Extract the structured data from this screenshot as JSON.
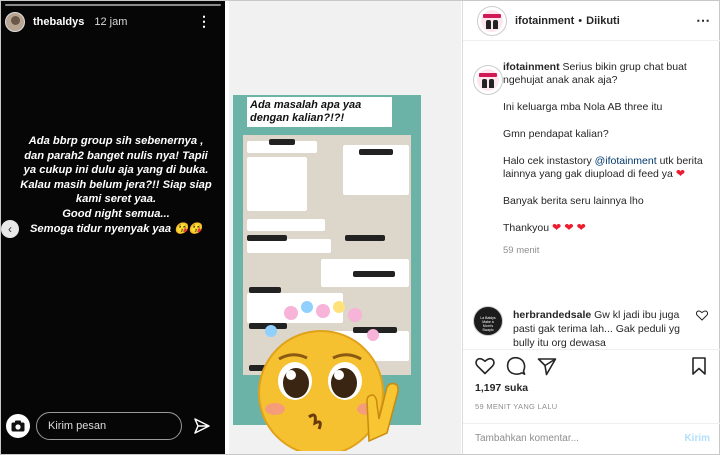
{
  "story": {
    "username": "thebaldys",
    "time": "12 jam",
    "lines": [
      "Ada bbrp group sih sebenernya ,",
      "dan parah2 banget nulis nya! Tapii",
      "ya cukup ini dulu aja yang di buka.",
      "Kalau masih belum jera?!! Siap siap",
      "kami seret yaa.",
      "Good night semua...",
      "Semoga tidur nyenyak yaa 😘😘"
    ],
    "message_placeholder": "Kirim pesan"
  },
  "post_media": {
    "caption_line1": "Ada masalah apa yaa",
    "caption_line2": "dengan kalian?!?!"
  },
  "post": {
    "header": {
      "username": "ifotainment",
      "separator": "•",
      "follow_status": "Diikuti"
    },
    "caption": {
      "username": "ifotainment",
      "line1": "Serius bikin grup chat buat ngehujat anak anak aja?",
      "line2": "Ini keluarga mba Nola AB three itu",
      "line3": "Gmn pendapat kalian?",
      "line4_before": "Halo cek instastory ",
      "line4_mention": "@ifotainment",
      "line4_after": " utk berita lainnya yang gak diupload di feed ya",
      "line5": "Banyak berita seru lainnya lho",
      "line6": "Thankyou",
      "hearts_one": "❤",
      "hearts_three": "❤ ❤ ❤",
      "time": "59 menit"
    },
    "comment": {
      "avatar_text": "La Baldys Make a Mom's Swaylo",
      "username": "herbrandedsale",
      "text": "Gw kl jadi ibu juga pasti gak terima lah... Gak peduli yg bully itu org dewasa"
    },
    "likes": "1,197 suka",
    "posted_ago": "59 MENIT YANG LALU",
    "add_comment_placeholder": "Tambahkan komentar...",
    "post_button": "Kirim"
  }
}
